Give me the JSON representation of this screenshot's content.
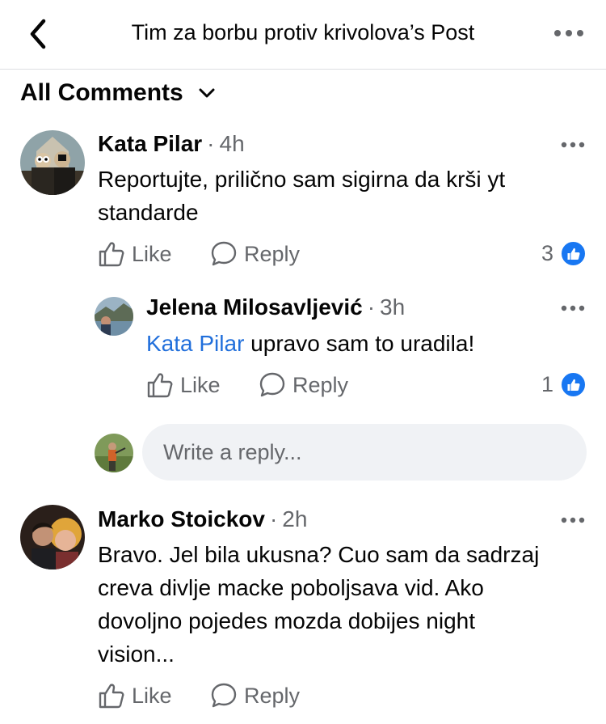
{
  "header": {
    "title": "Tim za borbu protiv krivolova’s Post"
  },
  "sort": {
    "label": "All Comments"
  },
  "comments": [
    {
      "author": "Kata Pilar",
      "time": "4h",
      "text_line1": "Reportujte, prilično sam sigirna da krši yt",
      "text_line2": "standarde",
      "like_label": "Like",
      "reply_label": "Reply",
      "reaction_count": "3",
      "replies": [
        {
          "author": "Jelena Milosavljević",
          "time": "3h",
          "mention": "Kata Pilar",
          "text": " upravo sam to uradila!",
          "like_label": "Like",
          "reply_label": "Reply",
          "reaction_count": "1"
        }
      ],
      "reply_input_placeholder": "Write a reply..."
    },
    {
      "author": "Marko Stoickov",
      "time": "2h",
      "text_lines": [
        "Bravo. Jel bila ukusna? Cuo sam da sadrzaj",
        "creva divlje macke poboljsava vid. Ako",
        "dovoljno pojedes mozda dobijes night",
        "vision..."
      ],
      "like_label": "Like",
      "reply_label": "Reply"
    }
  ],
  "separator": "·"
}
